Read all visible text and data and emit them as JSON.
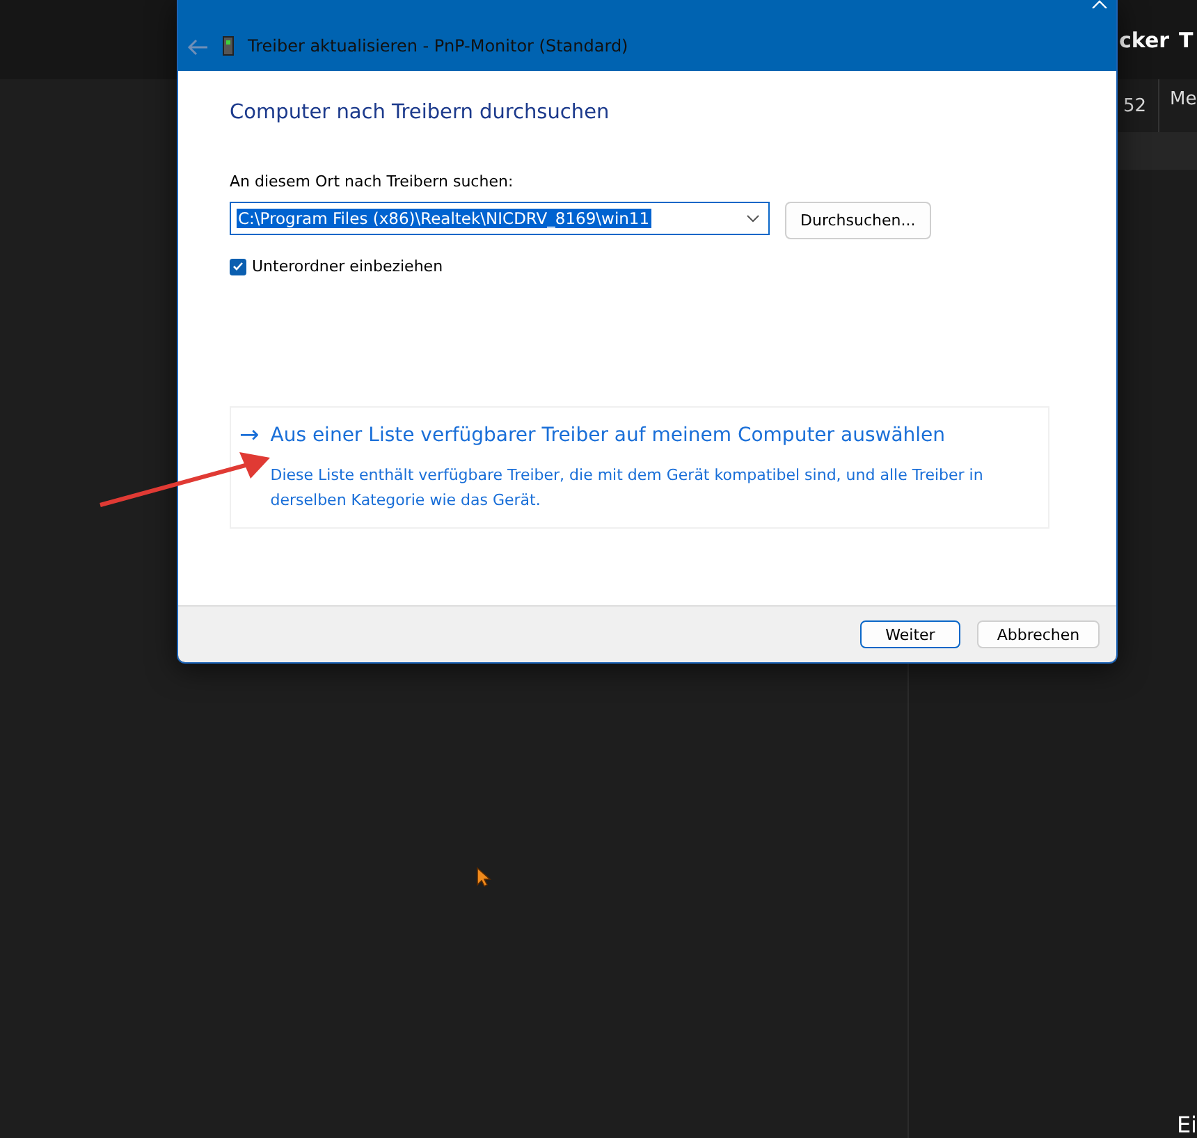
{
  "background_app": {
    "header_texts": [
      "cker",
      "T"
    ],
    "tabs": [
      "52",
      "Me"
    ],
    "corner_text": "Ei"
  },
  "dialog": {
    "title": "Treiber aktualisieren - PnP-Monitor (Standard)",
    "heading": "Computer nach Treibern durchsuchen",
    "path_label": "An diesem Ort nach Treibern suchen:",
    "path_field": {
      "value": "C:\\Program Files (x86)\\Realtek\\NICDRV_8169\\win11",
      "selected": true
    },
    "browse_button": "Durchsuchen...",
    "include_subfolders": {
      "label": "Unterordner einbeziehen",
      "checked": true
    },
    "option": {
      "arrow": "→",
      "title": "Aus einer Liste verfügbarer Treiber auf meinem Computer auswählen",
      "description": "Diese Liste enthält verfügbare Treiber, die mit dem Gerät kompatibel sind, und alle Treiber in derselben Kategorie wie das Gerät."
    },
    "buttons": [
      {
        "label": "Weiter",
        "default": true
      },
      {
        "label": "Abbrechen",
        "default": false
      }
    ]
  }
}
